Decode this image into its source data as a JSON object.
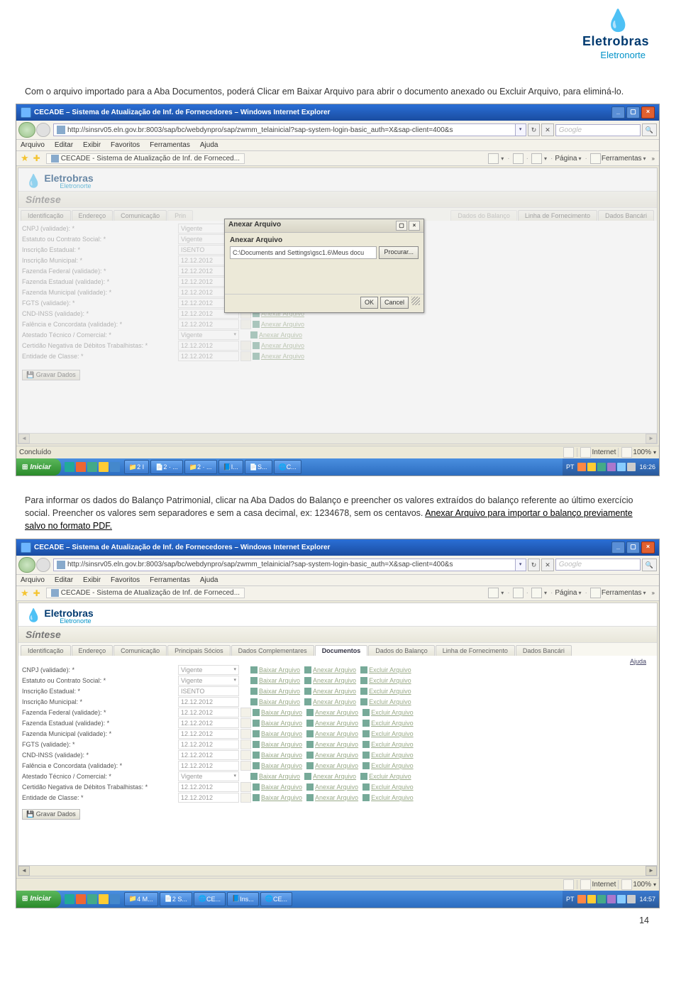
{
  "logo": {
    "brand": "Eletrobras",
    "sub": "Eletronorte"
  },
  "para1": "Com o arquivo importado para a Aba Documentos, poderá Clicar em Baixar Arquivo para abrir o documento anexado ou Excluir Arquivo, para eliminá-lo.",
  "para2_a": "Para informar os dados do Balanço Patrimonial, clicar na Aba Dados do Balanço e preencher os valores extraídos do balanço referente ao último exercício social. Preencher os valores sem separadores e sem a casa decimal, ex: 1234678, sem os centavos. ",
  "para2_link": "Anexar Arquivo para importar o balanço previamente salvo no formato PDF.",
  "pagenum": "14",
  "browser": {
    "title": "CECADE – Sistema de Atualização de Inf. de Fornecedores – Windows Internet Explorer",
    "url": "http://sinsrv05.eln.gov.br:8003/sap/bc/webdynpro/sap/zwmm_telainicial?sap-system-login-basic_auth=X&sap-client=400&s",
    "search": "Google",
    "menu": [
      "Arquivo",
      "Editar",
      "Exibir",
      "Favoritos",
      "Ferramentas",
      "Ajuda"
    ],
    "tab": "CECADE - Sistema de Atualização de Inf. de Forneced...",
    "favright": {
      "pagina": "Página",
      "ferramentas": "Ferramentas"
    },
    "status1": "Concluído",
    "status_mid": "Internet",
    "zoom": "100%",
    "taskbar": {
      "start": "Iniciar",
      "tasks1": [
        "2 I",
        "2 · ...",
        "2 · ...",
        "I...",
        "S...",
        "C..."
      ],
      "lang": "PT",
      "time1": "16:26",
      "tasks2": [
        "4 M...",
        "2 S...",
        "CE...",
        "Ins...",
        "CE..."
      ],
      "time2": "14:57"
    }
  },
  "app": {
    "logo": {
      "brand": "Eletrobras",
      "sub": "Eletronorte"
    },
    "sintese": "Síntese",
    "tabs": [
      "Identificação",
      "Endereço",
      "Comunicação",
      "Principais Sócios",
      "Dados Complementares",
      "Documentos",
      "Dados do Balanço",
      "Linha de Fornecimento",
      "Dados Bancári"
    ],
    "ajuda": "Ajuda",
    "gravar": "Gravar Dados",
    "labels": [
      "CNPJ (validade): *",
      "Estatuto ou Contrato Social: *",
      "Inscrição Estadual: *",
      "Inscrição Municipal: *",
      "Fazenda Federal (validade): *",
      "Fazenda Estadual (validade): *",
      "Fazenda Municipal (validade): *",
      "FGTS (validade): *",
      "CND-INSS (validade): *",
      "Falência e Concordata (validade): *",
      "Atestado Técnico / Comercial: *",
      "Certidão Negativa de Débitos Trabalhistas: *",
      "Entidade de Classe: *"
    ],
    "vals": {
      "vigente": "Vigente",
      "isento": "ISENTO",
      "date": "12.12.2012"
    },
    "links": {
      "anexar": "Anexar Arquivo",
      "baixar": "Baixar Arquivo",
      "excluir": "Excluir Arquivo"
    }
  },
  "modal": {
    "title": "Anexar Arquivo",
    "label": "Anexar Arquivo",
    "val": "C:\\Documents and Settings\\gsc1.6\\Meus docu",
    "procurar": "Procurar...",
    "ok": "OK",
    "cancel": "Cancel"
  }
}
